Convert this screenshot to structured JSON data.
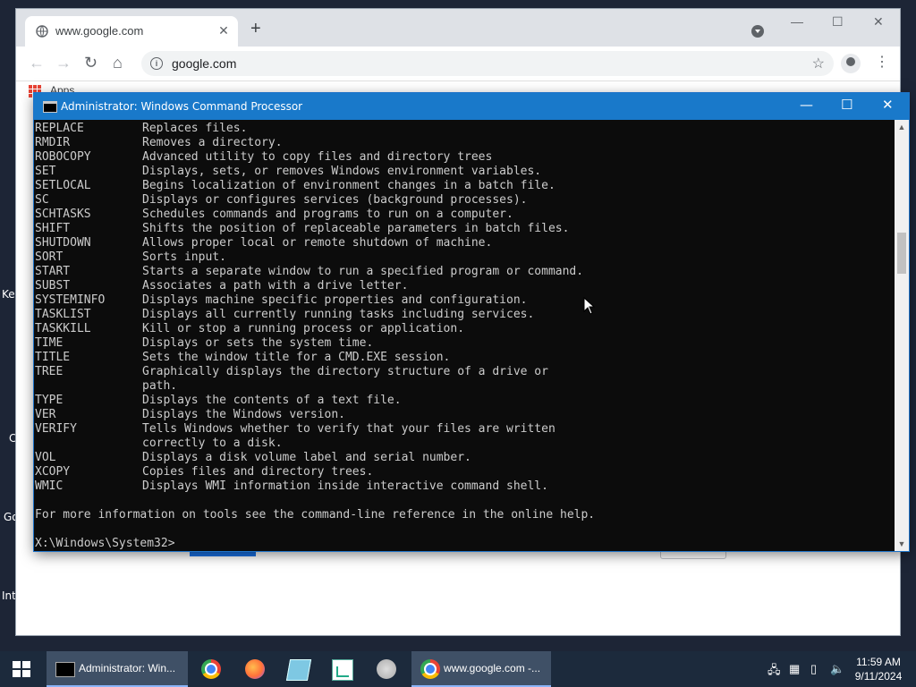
{
  "desktop": {
    "labels": [
      "Key",
      "C",
      "Go",
      "Int"
    ]
  },
  "chrome": {
    "tab_title": "www.google.com",
    "url": "google.com",
    "bookmarks_apps": "Apps"
  },
  "cmd": {
    "title": "Administrator: Windows Command Processor",
    "lines": [
      {
        "name": "REPLACE",
        "desc": "Replaces files."
      },
      {
        "name": "RMDIR",
        "desc": "Removes a directory."
      },
      {
        "name": "ROBOCOPY",
        "desc": "Advanced utility to copy files and directory trees"
      },
      {
        "name": "SET",
        "desc": "Displays, sets, or removes Windows environment variables."
      },
      {
        "name": "SETLOCAL",
        "desc": "Begins localization of environment changes in a batch file."
      },
      {
        "name": "SC",
        "desc": "Displays or configures services (background processes)."
      },
      {
        "name": "SCHTASKS",
        "desc": "Schedules commands and programs to run on a computer."
      },
      {
        "name": "SHIFT",
        "desc": "Shifts the position of replaceable parameters in batch files."
      },
      {
        "name": "SHUTDOWN",
        "desc": "Allows proper local or remote shutdown of machine."
      },
      {
        "name": "SORT",
        "desc": "Sorts input."
      },
      {
        "name": "START",
        "desc": "Starts a separate window to run a specified program or command."
      },
      {
        "name": "SUBST",
        "desc": "Associates a path with a drive letter."
      },
      {
        "name": "SYSTEMINFO",
        "desc": "Displays machine specific properties and configuration."
      },
      {
        "name": "TASKLIST",
        "desc": "Displays all currently running tasks including services."
      },
      {
        "name": "TASKKILL",
        "desc": "Kill or stop a running process or application."
      },
      {
        "name": "TIME",
        "desc": "Displays or sets the system time."
      },
      {
        "name": "TITLE",
        "desc": "Sets the window title for a CMD.EXE session."
      },
      {
        "name": "TREE",
        "desc": "Graphically displays the directory structure of a drive or"
      },
      {
        "name": "",
        "desc": "path."
      },
      {
        "name": "TYPE",
        "desc": "Displays the contents of a text file."
      },
      {
        "name": "VER",
        "desc": "Displays the Windows version."
      },
      {
        "name": "VERIFY",
        "desc": "Tells Windows whether to verify that your files are written"
      },
      {
        "name": "",
        "desc": "correctly to a disk."
      },
      {
        "name": "VOL",
        "desc": "Displays a disk volume label and serial number."
      },
      {
        "name": "XCOPY",
        "desc": "Copies files and directory trees."
      },
      {
        "name": "WMIC",
        "desc": "Displays WMI information inside interactive command shell."
      },
      {
        "name": "",
        "desc": ""
      },
      {
        "name": "",
        "desc": "For more information on tools see the command-line reference in the online help."
      },
      {
        "name": "",
        "desc": ""
      }
    ],
    "prompt": "X:\\Windows\\System32>"
  },
  "taskbar": {
    "cmd_label": "Administrator: Win...",
    "chrome_label": "www.google.com -...",
    "time": "11:59 AM",
    "date": "9/11/2024"
  }
}
